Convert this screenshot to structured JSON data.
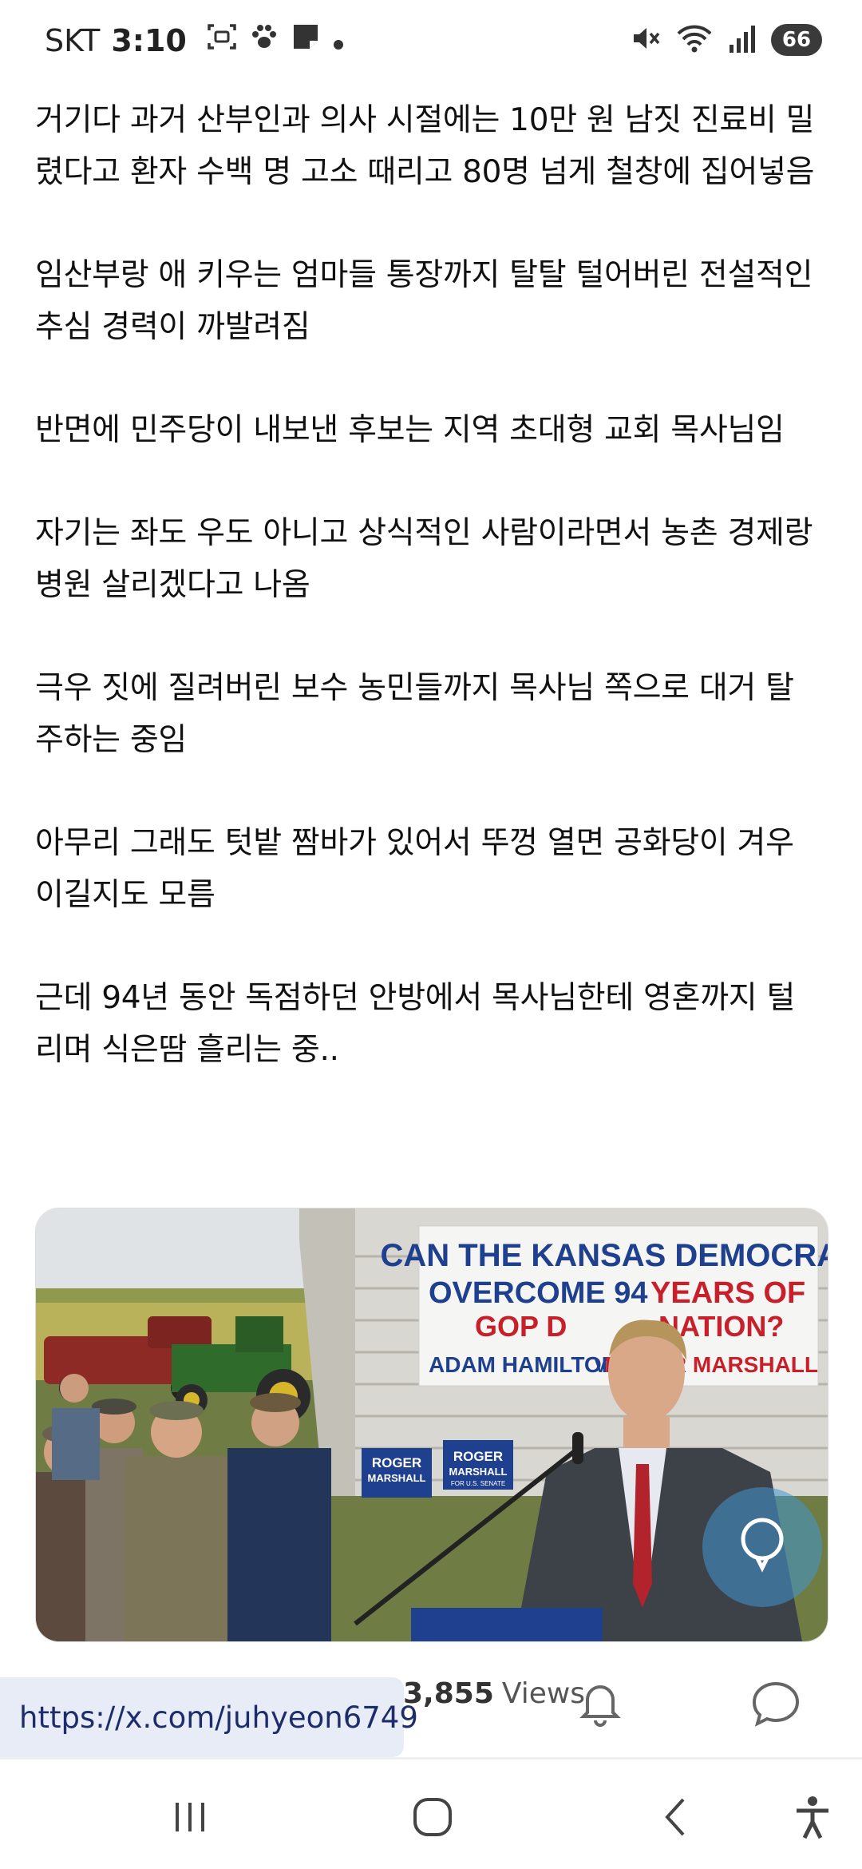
{
  "status_bar": {
    "carrier": "SKT",
    "time": "3:10",
    "battery": "66",
    "left_icons": [
      "screenshot-icon",
      "paw-icon",
      "note-icon",
      "dot-icon"
    ],
    "right_icons": [
      "mute-icon",
      "wifi-icon",
      "signal-icon",
      "battery-icon"
    ]
  },
  "article": {
    "paragraphs": [
      "거기다 과거 산부인과 의사 시절에는 10만 원 남짓 진료비 밀렸다고 환자 수백 명 고소 때리고 80명 넘게 철창에 집어넣음",
      "임산부랑 애 키우는 엄마들 통장까지 탈탈 털어버린 전설적인 추심 경력이 까발려짐",
      "반면에 민주당이 내보낸 후보는 지역 초대형 교회 목사님임",
      "자기는 좌도 우도 아니고 상식적인 사람이라면서 농촌 경제랑 병원 살리겠다고 나옴",
      "극우 짓에 질려버린 보수 농민들까지 목사님 쪽으로 대거 탈주하는 중임",
      "아무리 그래도 텃밭 짬바가 있어서 뚜껑 열면 공화당이 겨우 이길지도 모름",
      "근데 94년 동안 독점하던 안방에서 목사님한테 영혼까지 털리며 식은땀 흘리는 중.."
    ]
  },
  "photo": {
    "banner_line1": "CAN THE KANSAS DEMOCRAT",
    "banner_line2a": "OVERCOME 94",
    "banner_line2b": "YEARS OF",
    "banner_line3a": "GOP D",
    "banner_line3b": "NATION?",
    "banner_line4a": "ADAM HAMILTON",
    "banner_vs": "VS.",
    "banner_line4b": "ROGER MARSHALL",
    "sign_name": "ROGER",
    "sign_name2": "MARSHALL",
    "sign_sub": "FOR U.S. SENATE"
  },
  "actions": {
    "views_count": "3,855",
    "views_label": "Views",
    "url_toast": "https://x.com/juhyeon6749"
  },
  "colors": {
    "banner_blue": "#1f3f8f",
    "banner_red": "#c8202b",
    "fab_blue": "#4296d2",
    "toast_bg": "#e8ecf6"
  }
}
